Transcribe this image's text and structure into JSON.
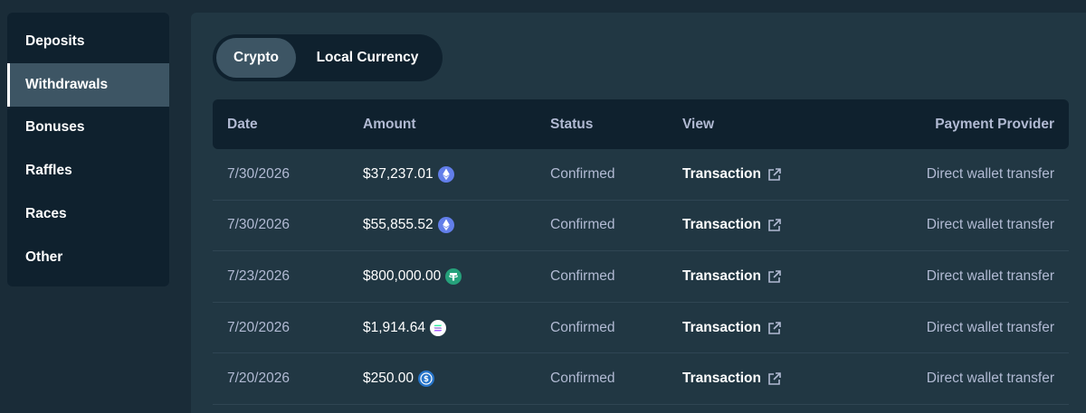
{
  "sidebar": {
    "items": [
      {
        "label": "Deposits",
        "active": false
      },
      {
        "label": "Withdrawals",
        "active": true
      },
      {
        "label": "Bonuses",
        "active": false
      },
      {
        "label": "Raffles",
        "active": false
      },
      {
        "label": "Races",
        "active": false
      },
      {
        "label": "Other",
        "active": false
      }
    ]
  },
  "toggle": {
    "crypto": "Crypto",
    "local": "Local Currency",
    "selected": "Crypto"
  },
  "table": {
    "headers": {
      "date": "Date",
      "amount": "Amount",
      "status": "Status",
      "view": "View",
      "provider": "Payment Provider"
    },
    "rows": [
      {
        "date": "7/30/2026",
        "amount": "$37,237.01",
        "coin": "eth-icon",
        "status": "Confirmed",
        "view": "Transaction",
        "provider": "Direct wallet transfer"
      },
      {
        "date": "7/30/2026",
        "amount": "$55,855.52",
        "coin": "eth-icon",
        "status": "Confirmed",
        "view": "Transaction",
        "provider": "Direct wallet transfer"
      },
      {
        "date": "7/23/2026",
        "amount": "$800,000.00",
        "coin": "usdt-icon",
        "status": "Confirmed",
        "view": "Transaction",
        "provider": "Direct wallet transfer"
      },
      {
        "date": "7/20/2026",
        "amount": "$1,914.64",
        "coin": "sol-icon",
        "status": "Confirmed",
        "view": "Transaction",
        "provider": "Direct wallet transfer"
      },
      {
        "date": "7/20/2026",
        "amount": "$250.00",
        "coin": "usdc-icon",
        "status": "Confirmed",
        "view": "Transaction",
        "provider": "Direct wallet transfer"
      }
    ]
  },
  "colors": {
    "background": "#1a2c38",
    "panel": "#213743",
    "dark": "#0f212e",
    "active": "#3d5564",
    "muted_text": "#b1bad3",
    "eth": "#627eea",
    "usdt": "#26a17b",
    "usdc": "#2775ca"
  }
}
